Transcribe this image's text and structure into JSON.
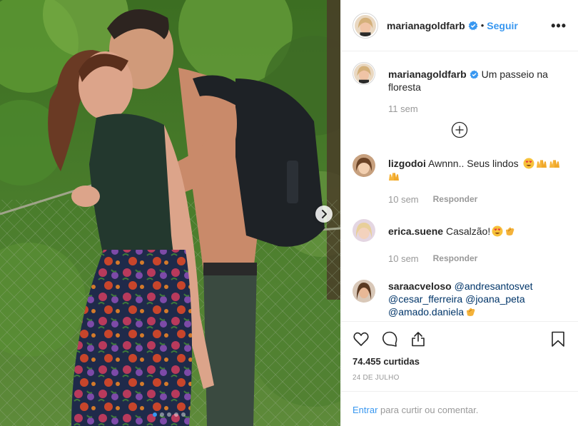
{
  "post": {
    "author": "marianagoldfarb",
    "follow_label": "Seguir",
    "bullet": "•",
    "more_label": "•••",
    "caption": "Um passeio na floresta",
    "caption_time": "11 sem",
    "image_dots": 5,
    "active_dot": 1
  },
  "comments": [
    {
      "user": "lizgodoi",
      "text": "Awnnn.. Seus lindos",
      "emojis": [
        "heart-eyes",
        "raised-hands",
        "raised-hands",
        "raised-hands"
      ],
      "time": "10 sem",
      "reply_label": "Responder"
    },
    {
      "user": "erica.suene",
      "text": "Casalzão!",
      "emojis": [
        "heart-eyes",
        "clapping-hands"
      ],
      "time": "10 sem",
      "reply_label": "Responder"
    },
    {
      "user": "saraacveloso",
      "mentions": [
        "@andresantosvet",
        "@cesar_fferreira",
        "@joana_peta",
        "@amado.daniela"
      ],
      "emojis": [
        "clapping-hands"
      ]
    }
  ],
  "actions": {
    "likes": "74.455 curtidas",
    "date": "24 DE JULHO",
    "login_link": "Entrar",
    "login_text": " para curtir ou comentar."
  },
  "colors": {
    "link": "#3897f0",
    "mention": "#003569",
    "muted": "#999999",
    "text": "#262626"
  },
  "icons": [
    "verified-badge-icon",
    "more-options-icon",
    "add-comments-icon",
    "heart-icon",
    "comment-icon",
    "share-icon",
    "bookmark-icon",
    "chevron-right-icon"
  ]
}
